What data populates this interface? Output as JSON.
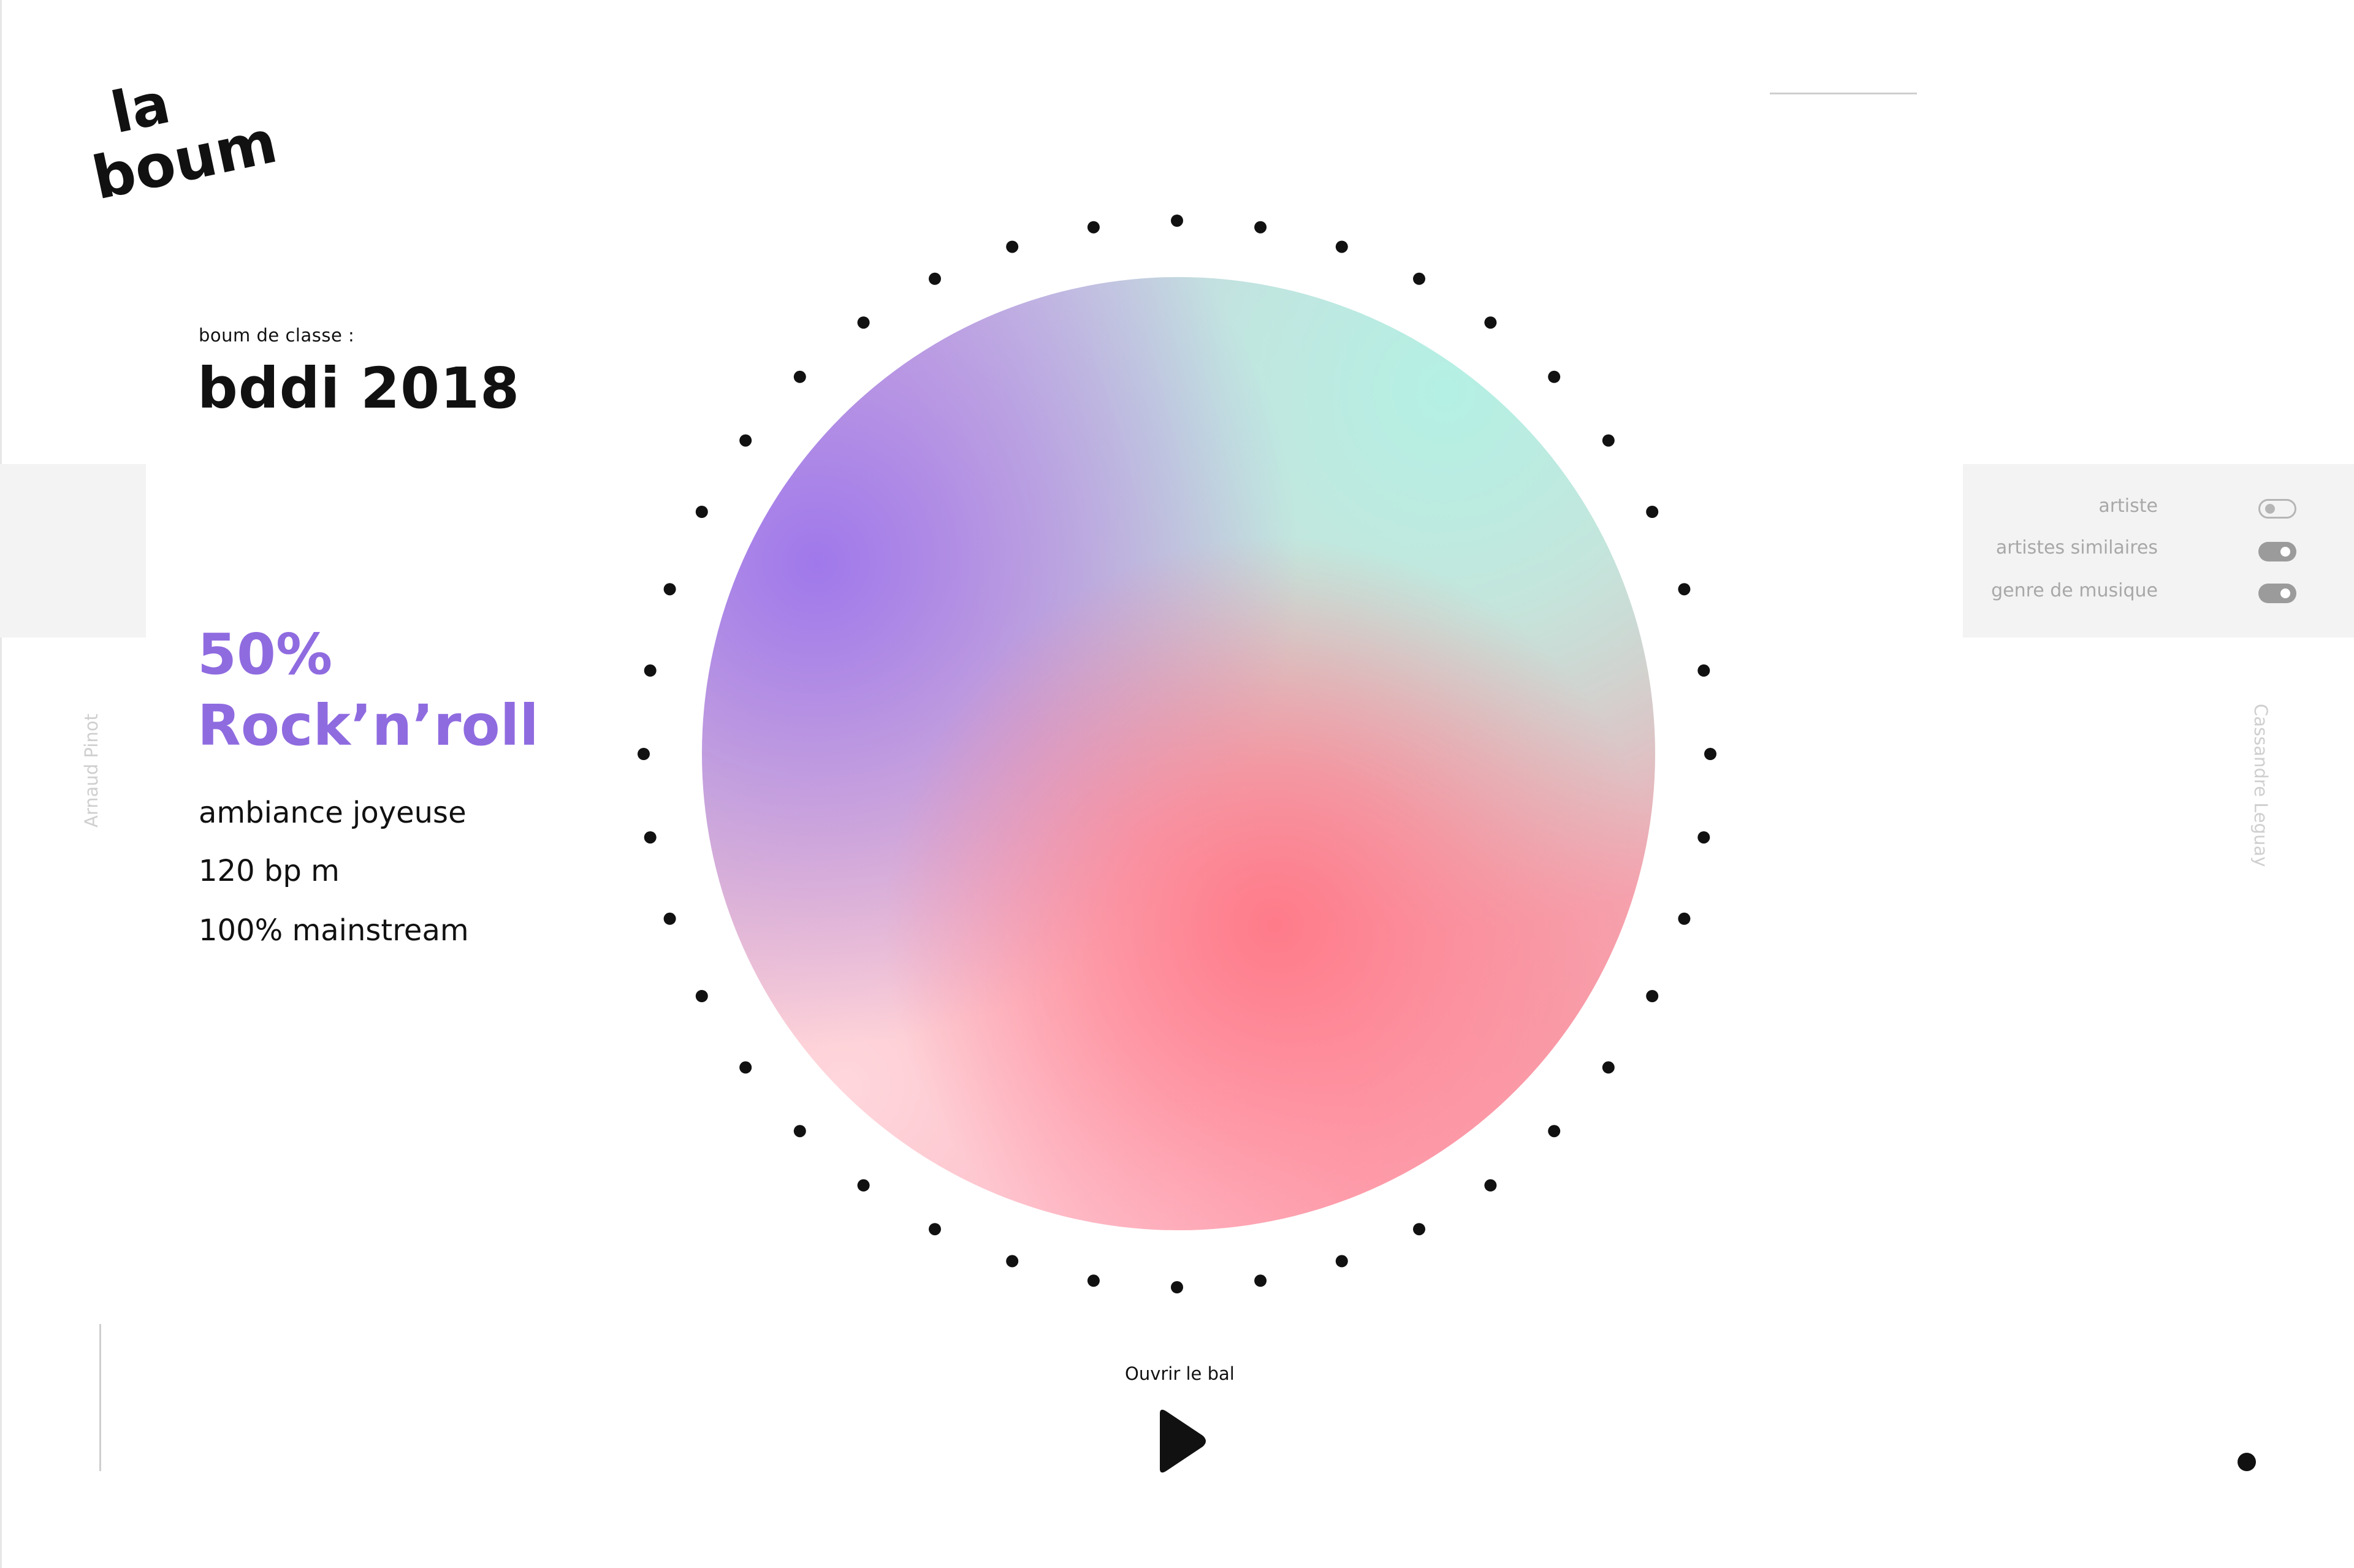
{
  "brand": {
    "logo_line1": "la",
    "logo_line2": "boum"
  },
  "event": {
    "label": "boum de classe :",
    "title": "bddi 2018"
  },
  "genre": {
    "percent": "50%",
    "name": "Rock’n’roll"
  },
  "stats": {
    "ambiance": "ambiance joyeuse",
    "bpm": "120 bp m",
    "mainstream": "100% mainstream"
  },
  "credits": {
    "left": "Arnaud Pinot",
    "right": "Cassandre Leguay"
  },
  "filters": [
    {
      "label": "artiste",
      "enabled": false
    },
    {
      "label": "artistes similaires",
      "enabled": true
    },
    {
      "label": "genre de musique",
      "enabled": true
    }
  ],
  "player": {
    "label": "Ouvrir le bal",
    "icon": "play-icon"
  },
  "colors": {
    "accent": "#8f6be0",
    "text": "#111111",
    "panel": "#f3f3f3",
    "muted": "#a8a8a8"
  }
}
